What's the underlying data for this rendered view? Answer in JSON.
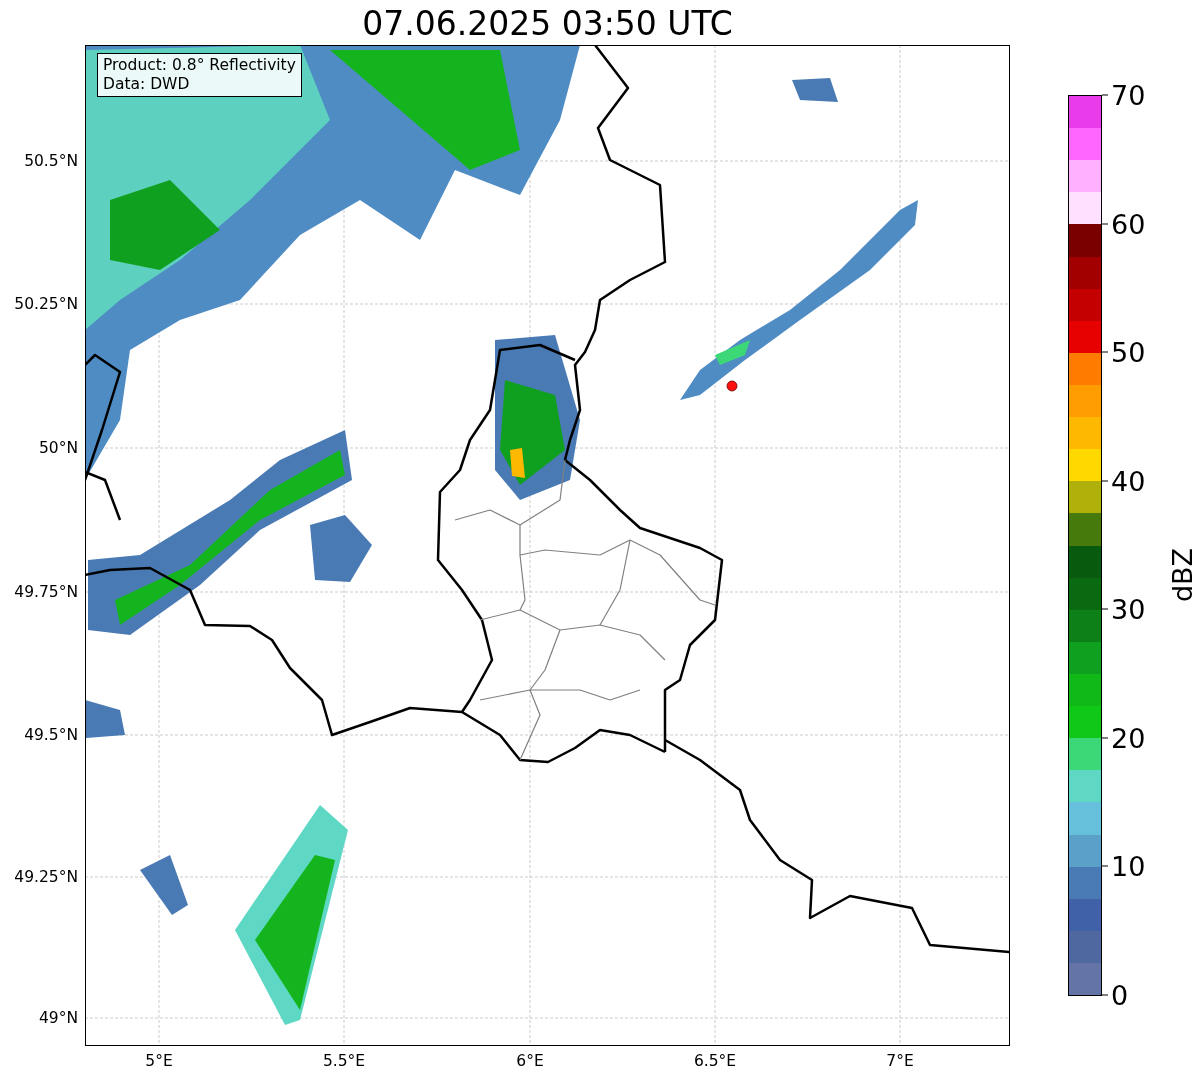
{
  "title": "07.06.2025 03:50 UTC",
  "map": {
    "legend": [
      "Product: 0.8° Reflectivity",
      "Data: DWD"
    ],
    "y_ticks": [
      "50.5°N",
      "50.25°N",
      "50°N",
      "49.75°N",
      "49.5°N",
      "49.25°N",
      "49°N"
    ],
    "x_ticks": [
      "5°E",
      "5.5°E",
      "6°E",
      "6.5°E",
      "7°E"
    ]
  },
  "colorbar": {
    "label": "dBZ",
    "ticks": [
      "70",
      "60",
      "50",
      "40",
      "30",
      "20",
      "10",
      "0"
    ],
    "bins": [
      {
        "color": "#e93be9"
      },
      {
        "color": "#ff66ff"
      },
      {
        "color": "#ffb0ff"
      },
      {
        "color": "#ffe0ff"
      },
      {
        "color": "#7a0000"
      },
      {
        "color": "#a20000"
      },
      {
        "color": "#c40000"
      },
      {
        "color": "#e60000"
      },
      {
        "color": "#ff7c00"
      },
      {
        "color": "#ff9c00"
      },
      {
        "color": "#ffb800"
      },
      {
        "color": "#ffd800"
      },
      {
        "color": "#b0b00a"
      },
      {
        "color": "#467a0c"
      },
      {
        "color": "#085a0e"
      },
      {
        "color": "#0a6a12"
      },
      {
        "color": "#0e8018"
      },
      {
        "color": "#10a020"
      },
      {
        "color": "#10b818"
      },
      {
        "color": "#10c818"
      },
      {
        "color": "#3cd878"
      },
      {
        "color": "#5ed8c4"
      },
      {
        "color": "#66c0dc"
      },
      {
        "color": "#5aa0c8"
      },
      {
        "color": "#4a7ab4"
      },
      {
        "color": "#4060a8"
      },
      {
        "color": "#5068a0"
      },
      {
        "color": "#6474a6"
      }
    ]
  }
}
